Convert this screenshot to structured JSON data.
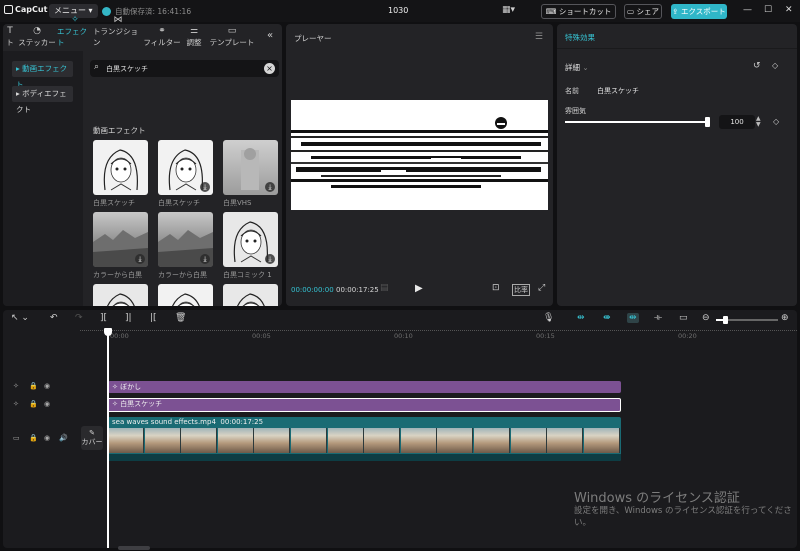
{
  "titlebar": {
    "app_name": "CapCut",
    "menu_label": "メニュー",
    "autosave": "自動保存済: 16:41:16",
    "time": "1030",
    "shortcut_label": "ショートカット",
    "share_label": "シェア",
    "export_label": "エクスポート"
  },
  "tabs": [
    {
      "label": "ト",
      "icon": "text-icon",
      "active": false
    },
    {
      "label": "ステッカー",
      "icon": "sticker-icon",
      "active": false
    },
    {
      "label": "エフェクト",
      "icon": "effects-icon",
      "active": true
    },
    {
      "label": "トランジション",
      "icon": "transition-icon",
      "active": false
    },
    {
      "label": "フィルター",
      "icon": "filter-icon",
      "active": false
    },
    {
      "label": "調整",
      "icon": "adjust-icon",
      "active": false
    },
    {
      "label": "テンプレート",
      "icon": "template-icon",
      "active": false
    }
  ],
  "categories": [
    {
      "label": "▸ 動画エフェクト",
      "active": true
    },
    {
      "label": "▸ ボディエフェクト",
      "active": false
    }
  ],
  "search": {
    "value": "白黒スケッチ"
  },
  "effects": {
    "section_title": "動画エフェクト",
    "items": [
      {
        "label": "白黒スケッチ",
        "style": "sketch",
        "download": false
      },
      {
        "label": "白黒スケッチ",
        "style": "sketch",
        "download": true
      },
      {
        "label": "白黒VHS",
        "style": "vhs",
        "download": true
      },
      {
        "label": "カラーから白黒",
        "style": "landscape",
        "download": true
      },
      {
        "label": "カラーから白黒",
        "style": "landscape",
        "download": true
      },
      {
        "label": "白黒コミック 1",
        "style": "comic",
        "download": true
      },
      {
        "label": "",
        "style": "comic",
        "download": false
      },
      {
        "label": "",
        "style": "sketch",
        "download": false
      },
      {
        "label": "",
        "style": "comic",
        "download": false
      }
    ]
  },
  "player": {
    "title": "プレーヤー",
    "current_time": "00:00:00:00",
    "total_time": "00:00:17:25",
    "ratio_label": "比率"
  },
  "inspector": {
    "title": "特殊効果",
    "section": "詳細",
    "name_label": "名前",
    "name_value": "白黒スケッチ",
    "param_label": "雰囲気",
    "param_value": "100",
    "param_fraction": 1.0
  },
  "timeline": {
    "ruler_labels": [
      "00:00",
      "00:05",
      "00:10",
      "00:15",
      "00:20"
    ],
    "tracks": {
      "effect1": "ぼかし",
      "effect2": "白黒スケッチ",
      "video_name": "sea waves sound effects.mp4",
      "video_duration": "00:00:17:25"
    },
    "cover_label": "カバー"
  },
  "watermark": {
    "line1": "Windows のライセンス認証",
    "line2": "設定を開き、Windows のライセンス認証を行ってください。"
  },
  "colors": {
    "accent": "#37c3d3",
    "export": "#2fb6c8",
    "effect_clip": "#7c5193",
    "video_clip": "#1a6b74"
  }
}
